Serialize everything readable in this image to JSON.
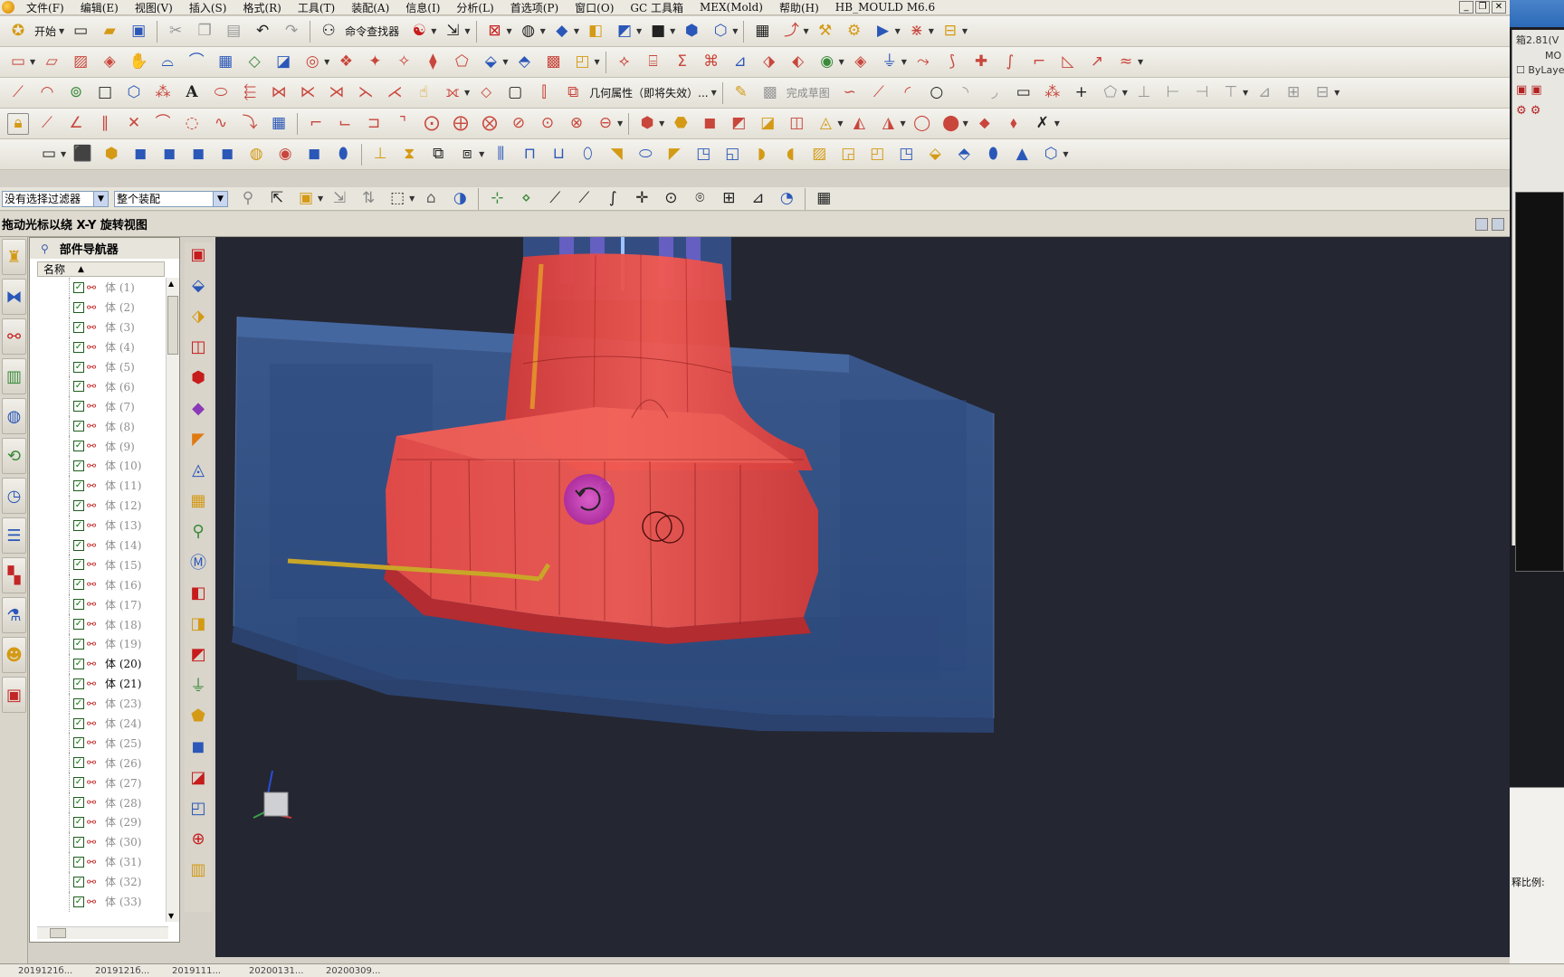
{
  "menu": [
    "文件(F)",
    "编辑(E)",
    "视图(V)",
    "插入(S)",
    "格式(R)",
    "工具(T)",
    "装配(A)",
    "信息(I)",
    "分析(L)",
    "首选项(P)",
    "窗口(O)",
    "GC 工具箱",
    "MEX(Mold)",
    "帮助(H)",
    "HB_MOULD M6.6"
  ],
  "toolbar": {
    "start_label": "开始",
    "command_finder_label": "命令查找器",
    "geom_props_label": "几何属性（即将失效）...",
    "finish_sketch_label": "完成草图"
  },
  "selection": {
    "filter_value": "没有选择过滤器",
    "scope_value": "整个装配"
  },
  "cue": "拖动光标以绕 X-Y 旋转视图",
  "navigator": {
    "title": "部件导航器",
    "col_name": "名称",
    "body_label": "体",
    "rows": [
      {
        "idx": "(1)"
      },
      {
        "idx": "(2)"
      },
      {
        "idx": "(3)"
      },
      {
        "idx": "(4)"
      },
      {
        "idx": "(5)"
      },
      {
        "idx": "(6)"
      },
      {
        "idx": "(7)"
      },
      {
        "idx": "(8)"
      },
      {
        "idx": "(9)"
      },
      {
        "idx": "(10)"
      },
      {
        "idx": "(11)"
      },
      {
        "idx": "(12)"
      },
      {
        "idx": "(13)"
      },
      {
        "idx": "(14)"
      },
      {
        "idx": "(15)"
      },
      {
        "idx": "(16)"
      },
      {
        "idx": "(17)"
      },
      {
        "idx": "(18)"
      },
      {
        "idx": "(19)"
      },
      {
        "idx": "(20)",
        "active": true
      },
      {
        "idx": "(21)",
        "active": true
      },
      {
        "idx": "(23)"
      },
      {
        "idx": "(24)"
      },
      {
        "idx": "(25)"
      },
      {
        "idx": "(26)"
      },
      {
        "idx": "(27)"
      },
      {
        "idx": "(28)"
      },
      {
        "idx": "(29)"
      },
      {
        "idx": "(30)"
      },
      {
        "idx": "(31)"
      },
      {
        "idx": "(32)"
      },
      {
        "idx": "(33)"
      }
    ]
  },
  "taskbar": [
    "2019121б...",
    "2019121б...",
    "2019111...",
    "20200131...",
    "20200309..."
  ],
  "side": {
    "title_fragment": "箱2.81(V",
    "text1": "MO",
    "bylayer": "ByLayer",
    "scale_label": "释比例:"
  },
  "colors": {
    "viewport_bg": "#242631",
    "core_red": "#e8413c",
    "mold_blue": "#3d5f9a",
    "runner_yellow": "#c9a628"
  }
}
